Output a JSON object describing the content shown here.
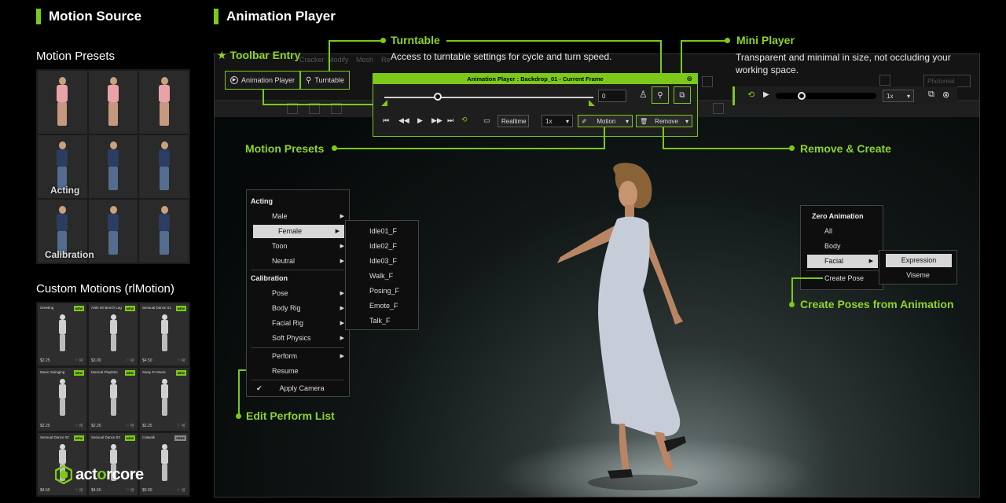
{
  "sections": {
    "motion_source": "Motion Source",
    "animation_player": "Animation Player",
    "motion_presets": "Motion Presets",
    "custom_motions": "Custom Motions (rlMotion)"
  },
  "preset_labels": [
    "Acting",
    "Calibration"
  ],
  "custom_items": [
    {
      "name": "Greeting",
      "badge": "NEW",
      "price": "$2.25"
    },
    {
      "name": "Aisle 50 Bench Leg",
      "badge": "NEW",
      "price": "$3.00"
    },
    {
      "name": "Sensual Dance 01",
      "badge": "NEW",
      "price": "$4.50"
    },
    {
      "name": "Music Swinging",
      "badge": "NEW",
      "price": "$2.25"
    },
    {
      "name": "Musical Playtime",
      "badge": "NEW",
      "price": "$2.25"
    },
    {
      "name": "Sway To Music",
      "badge": "NEW",
      "price": "$2.25"
    },
    {
      "name": "Sensual Dance 02",
      "badge": "NEW",
      "price": "$4.50"
    },
    {
      "name": "Sensual Dance 03",
      "badge": "NEW",
      "price": "$4.50"
    },
    {
      "name": "Catwalk",
      "badge": "FREE",
      "price": "$0.00"
    }
  ],
  "logo": {
    "part1": "act",
    "part2": "o",
    "part3": "rcore"
  },
  "toolbar": {
    "entry_label": "Toolbar Entry",
    "animation_player_btn": "Animation Player",
    "turntable_btn": "Turntable",
    "dim_menus": [
      "Cracker",
      "Modify",
      "Mesh",
      "Re"
    ],
    "render_mode": "Photoreal"
  },
  "annotations": {
    "turntable": "Turntable",
    "turntable_desc": "Access to turntable settings for cycle and turn speed.",
    "mini_player": "Mini Player",
    "mini_player_desc": "Transparent and minimal in size, not occluding your working space.",
    "motion_presets": "Motion Presets",
    "remove_create": "Remove & Create",
    "edit_perform": "Edit Perform List",
    "create_poses": "Create Poses from Animation"
  },
  "player": {
    "title": "Animation Player : Backdrop_01 - Current Frame",
    "frame_value": "0",
    "realtime": "Realtime",
    "speed": "1x",
    "motion": "Motion",
    "remove": "Remove"
  },
  "mini_player": {
    "speed": "1x"
  },
  "menu_left": {
    "acting_header": "Acting",
    "acting_items": [
      "Male",
      "Female",
      "Toon",
      "Neutral"
    ],
    "calibration_header": "Calibration",
    "calibration_items": [
      "Pose",
      "Body Rig",
      "Facial Rig",
      "Soft Physics"
    ],
    "perform": "Perform",
    "resume": "Resume",
    "apply_camera": "Apply Camera",
    "check": "✔"
  },
  "submenu_female": [
    "Idle01_F",
    "Idle02_F",
    "Idle03_F",
    "Walk_F",
    "Posing_F",
    "Emote_F",
    "Talk_F"
  ],
  "menu_right": {
    "header": "Zero Animation",
    "items": [
      "All",
      "Body",
      "Facial"
    ],
    "create_pose": "Create Pose"
  },
  "submenu_facial": [
    "Expression",
    "Viseme"
  ],
  "colors": {
    "accent": "#7cc91a"
  }
}
